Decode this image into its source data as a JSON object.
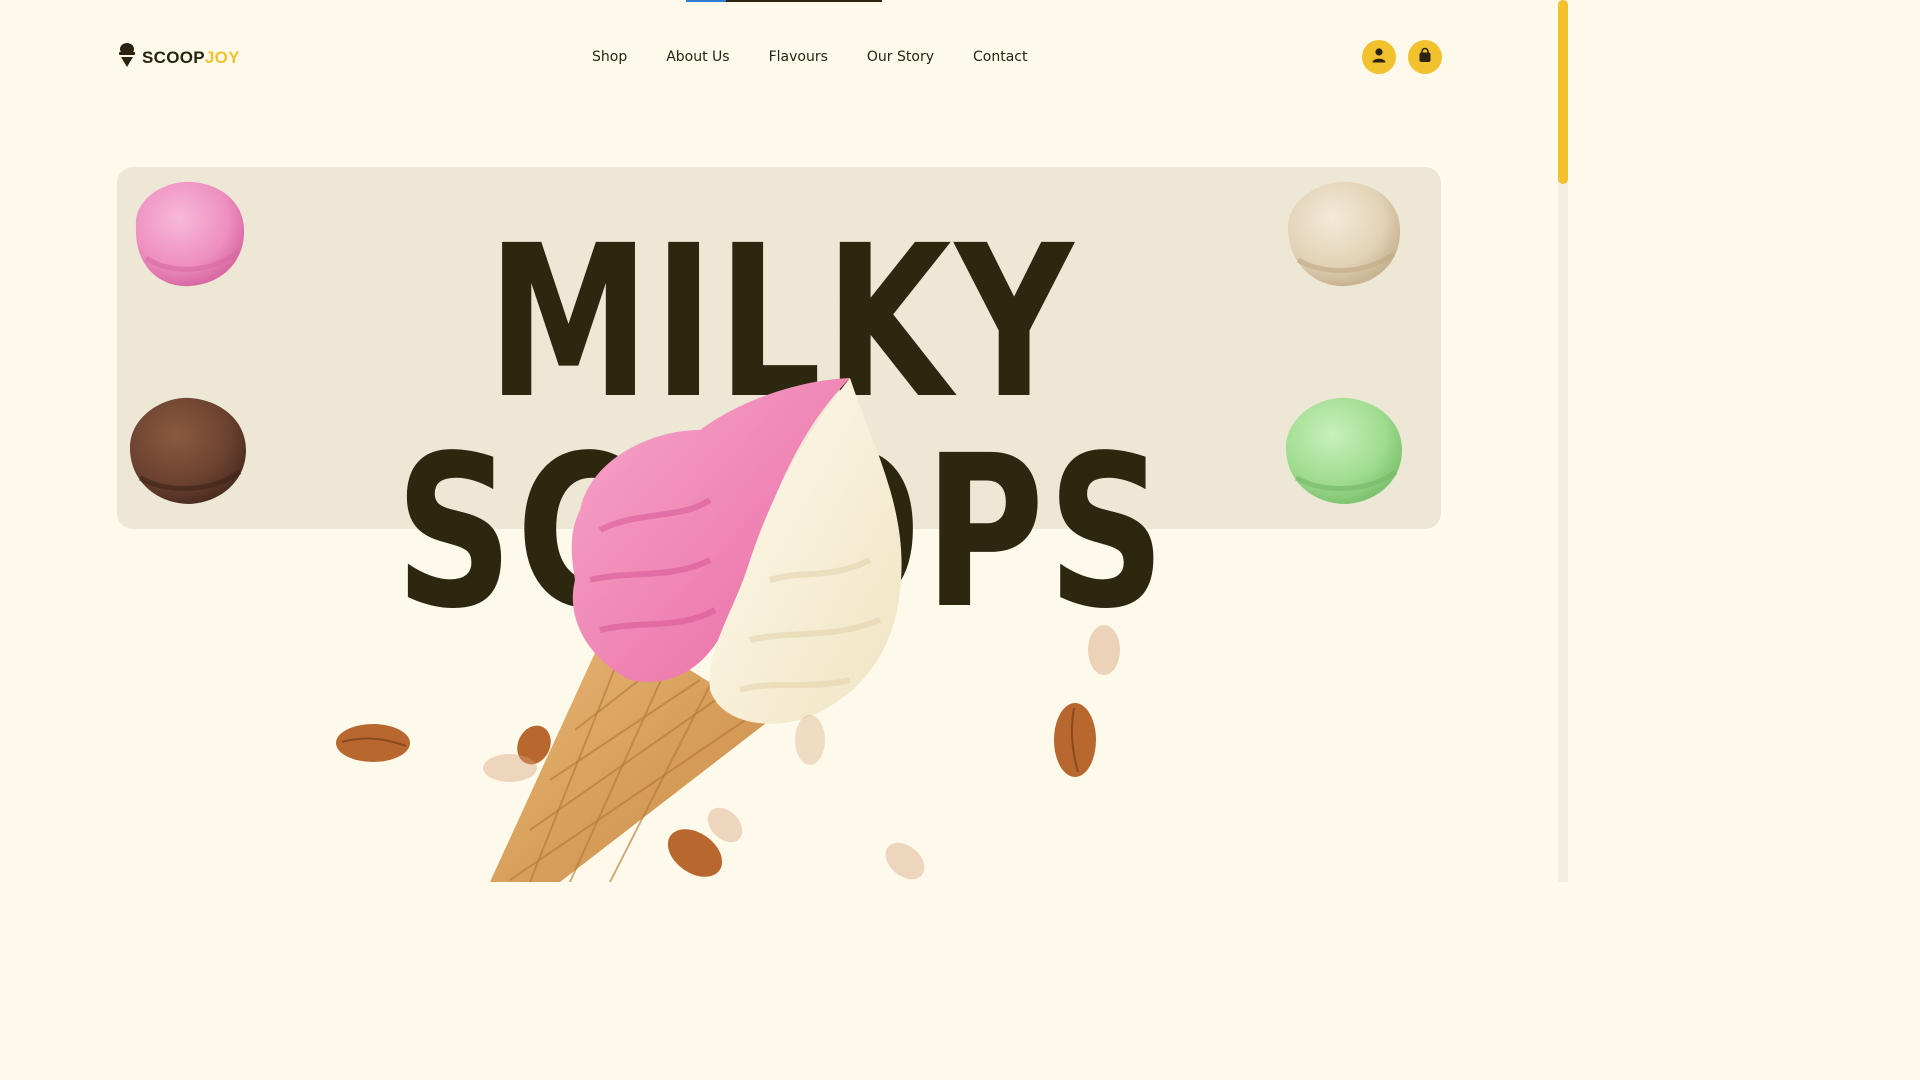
{
  "brand": {
    "name_part1": "SCOOP",
    "name_part2": "JOY",
    "accent_color": "#f2c12e",
    "text_color": "#2a230f"
  },
  "nav": {
    "items": [
      {
        "label": "Shop"
      },
      {
        "label": "About Us"
      },
      {
        "label": "Flavours"
      },
      {
        "label": "Our Story"
      },
      {
        "label": "Contact"
      }
    ]
  },
  "header_icons": {
    "account": "user-icon",
    "cart": "shopping-bag-icon"
  },
  "hero": {
    "title": "MILKY SCOOPS",
    "scoops": [
      "strawberry",
      "vanilla",
      "chocolate",
      "pistachio"
    ],
    "image": "ice-cream-cone-with-almonds"
  },
  "colors": {
    "background": "#fdfaec",
    "card": "#ede7d6",
    "title": "#2e2710",
    "scrollbar": "#f2c12e"
  }
}
